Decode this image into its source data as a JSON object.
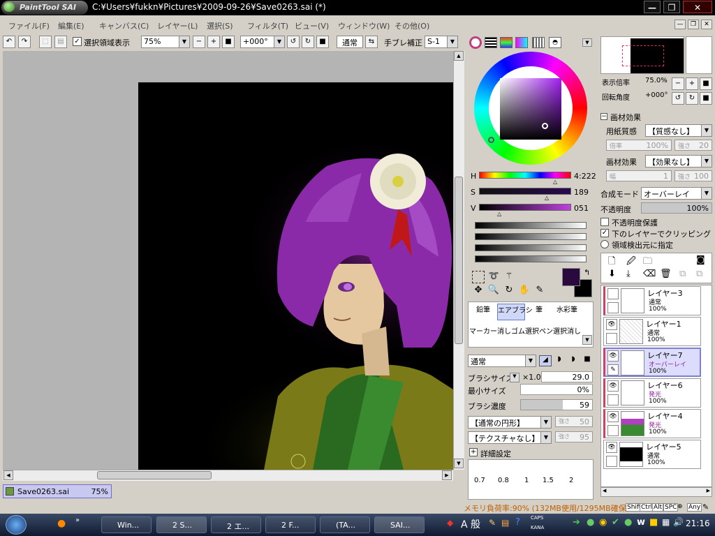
{
  "app": {
    "logo": "PaintTool SAI",
    "title": "C:¥Users¥fukkn¥Pictures¥2009-09-26¥Save0263.sai (*)"
  },
  "menu": [
    "ファイル(F)",
    "編集(E)",
    "キャンバス(C)",
    "レイヤー(L)",
    "選択(S)",
    "フィルタ(T)",
    "ビュー(V)",
    "ウィンドウ(W)",
    "その他(O)"
  ],
  "toolbar": {
    "show_selection_label": "選択領域表示",
    "zoom": "75%",
    "rotation": "+000°",
    "mode": "通常",
    "stabilizer_label": "手ブレ補正",
    "stabilizer": "S-1"
  },
  "document_tab": {
    "name": "Save0263.sai",
    "zoom": "75%"
  },
  "color": {
    "h_label": "H",
    "h_value": "4:222",
    "s_label": "S",
    "s_value": "189",
    "v_label": "V",
    "v_value": "051",
    "primary": "#2a0a3e",
    "secondary": "#000000"
  },
  "tools": [
    "鉛筆",
    "エアブラシ",
    "筆",
    "水彩筆",
    "マーカー",
    "消しゴム",
    "選択ペン",
    "選択消し"
  ],
  "brush": {
    "shape_mode": "通常",
    "size_label": "ブラシサイズ",
    "size_mult": "×1.0",
    "size": "29.0",
    "min_size_label": "最小サイズ",
    "min_size": "0%",
    "density_label": "ブラシ濃度",
    "density": "59",
    "shape": "【通常の円形】",
    "shape_strength_label": "強さ",
    "shape_strength": "50",
    "texture": "【テクスチャなし】",
    "texture_strength_label": "強さ",
    "texture_strength": "95",
    "advanced_label": "詳細設定",
    "presets": [
      "0.7",
      "0.8",
      "1",
      "1.5",
      "2"
    ]
  },
  "navigator": {
    "zoom_label": "表示倍率",
    "zoom": "75.0%",
    "angle_label": "回転角度",
    "angle": "+000°"
  },
  "material": {
    "header": "画材効果",
    "paper_label": "用紙質感",
    "paper": "【質感なし】",
    "scale_label": "倍率",
    "scale": "100%",
    "paper_strength_label": "強さ",
    "paper_strength": "20",
    "effect_label": "画材効果",
    "effect": "【効果なし】",
    "width_label": "幅",
    "width": "1",
    "effect_strength_label": "強さ",
    "effect_strength": "100"
  },
  "blend": {
    "mode_label": "合成モード",
    "mode": "オーバーレイ",
    "opacity_label": "不透明度",
    "opacity": "100%",
    "protect_label": "不透明度保護",
    "clip_label": "下のレイヤーでクリッピング",
    "source_label": "領域検出元に指定"
  },
  "layers": [
    {
      "name": "レイヤー3",
      "mode": "通常",
      "opacity": "100%",
      "visible": false,
      "selected": false,
      "marker": "#d04060"
    },
    {
      "name": "レイヤー1",
      "mode": "通常",
      "opacity": "100%",
      "visible": true,
      "selected": false,
      "marker": ""
    },
    {
      "name": "レイヤー7",
      "mode": "オーバーレイ",
      "opacity": "100%",
      "visible": true,
      "selected": true,
      "marker": "#d04060"
    },
    {
      "name": "レイヤー6",
      "mode": "発光",
      "opacity": "100%",
      "visible": true,
      "selected": false,
      "marker": "#d04060"
    },
    {
      "name": "レイヤー4",
      "mode": "発光",
      "opacity": "100%",
      "visible": true,
      "selected": false,
      "marker": "#d04060"
    },
    {
      "name": "レイヤー5",
      "mode": "通常",
      "opacity": "100%",
      "visible": true,
      "selected": false,
      "marker": ""
    }
  ],
  "status": {
    "memory": "メモリ負荷率:90% (132MB使用/1295MB確保)",
    "keys": [
      "Shift",
      "Ctrl",
      "Alt",
      "SPC",
      "Any"
    ]
  },
  "taskbar": {
    "items": [
      "Win...",
      "2 S...",
      "2 エ...",
      "2 F...",
      "(TA...",
      "SAI..."
    ],
    "ime": "A 般",
    "caps": "CAPS",
    "kana": "KANA",
    "clock": "21:16"
  }
}
